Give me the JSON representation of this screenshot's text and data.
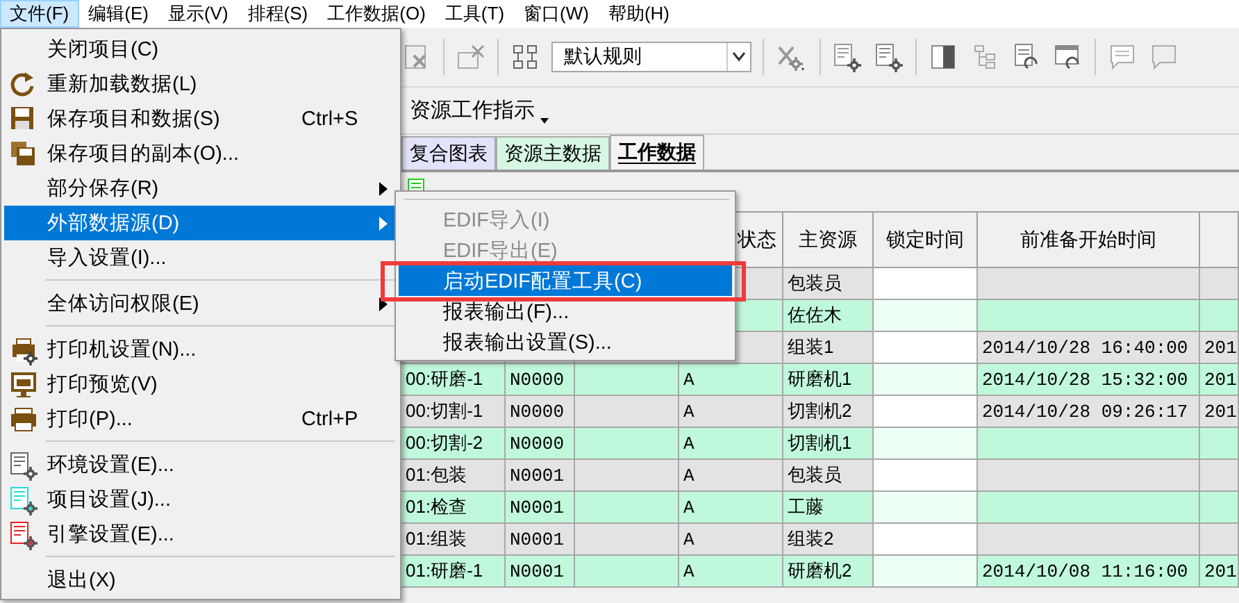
{
  "menu_bar": [
    {
      "label": "文件(F)",
      "selected": true
    },
    {
      "label": "编辑(E)",
      "selected": false
    },
    {
      "label": "显示(V)",
      "selected": false
    },
    {
      "label": "排程(S)",
      "selected": false
    },
    {
      "label": "工作数据(O)",
      "selected": false
    },
    {
      "label": "工具(T)",
      "selected": false
    },
    {
      "label": "窗口(W)",
      "selected": false
    },
    {
      "label": "帮助(H)",
      "selected": false
    }
  ],
  "toolbar": {
    "rule_select": {
      "value": "默认规则"
    }
  },
  "view_selector": {
    "label": "资源工作指示"
  },
  "tabs": [
    {
      "label": "复合图表",
      "selected": false,
      "color": "#e2e2fa"
    },
    {
      "label": "资源主数据",
      "selected": false,
      "color": "#d6f7e2"
    },
    {
      "label": "工作数据",
      "selected": true,
      "color": "#f4f4f4"
    }
  ],
  "table": {
    "columns": [
      {
        "label": "状态"
      },
      {
        "label": "主资源"
      },
      {
        "label": "锁定时间"
      },
      {
        "label": "前准备开始时间"
      }
    ],
    "rows": [
      {
        "main_resource": "包装员"
      },
      {
        "main_resource": "佐佐木"
      },
      {
        "main_resource": "组装1",
        "setup_start": "2014/10/28 16:40:00",
        "column_8": "201"
      },
      {
        "column_1": "00:研磨-1",
        "column_2": "N0000",
        "status": "A",
        "main_resource": "研磨机1",
        "setup_start": "2014/10/28 15:32:00",
        "column_8": "201"
      },
      {
        "column_1": "00:切割-1",
        "column_2": "N0000",
        "status": "A",
        "main_resource": "切割机2",
        "setup_start": "2014/10/28 09:26:17",
        "column_8": "201"
      },
      {
        "column_1": "00:切割-2",
        "column_2": "N0000",
        "status": "A",
        "main_resource": "切割机1"
      },
      {
        "column_1": "01:包装",
        "column_2": "N0001",
        "status": "A",
        "main_resource": "包装员"
      },
      {
        "column_1": "01:检查",
        "column_2": "N0001",
        "status": "A",
        "main_resource": "工藤"
      },
      {
        "column_1": "01:组装",
        "column_2": "N0001",
        "status": "A",
        "main_resource": "组装2"
      },
      {
        "column_1": "01:研磨-1",
        "column_2": "N0001",
        "status": "A",
        "main_resource": "研磨机2",
        "setup_start": "2014/10/08 11:16:00",
        "column_8": "201"
      }
    ]
  },
  "file_menu": {
    "items": [
      {
        "label": "关闭项目(C)",
        "selected": false,
        "separator_above": false,
        "submenu": false
      },
      {
        "label": "重新加载数据(L)",
        "selected": false,
        "separator_above": false,
        "submenu": false
      },
      {
        "label": "保存项目和数据(S)",
        "shortcut": "Ctrl+S",
        "selected": false,
        "separator_above": false,
        "submenu": false
      },
      {
        "label": "保存项目的副本(O)...",
        "selected": false,
        "separator_above": false,
        "submenu": false
      },
      {
        "label": "部分保存(R)",
        "selected": false,
        "separator_above": false,
        "submenu": true
      },
      {
        "label": "外部数据源(D)",
        "selected": true,
        "separator_above": false,
        "submenu": true
      },
      {
        "label": "导入设置(I)...",
        "selected": false,
        "separator_above": false,
        "submenu": false
      },
      {
        "label": "全体访问权限(E)",
        "selected": false,
        "separator_above": true,
        "submenu": true
      },
      {
        "label": "打印机设置(N)...",
        "selected": false,
        "separator_above": true,
        "submenu": false
      },
      {
        "label": "打印预览(V)",
        "selected": false,
        "separator_above": false,
        "submenu": false
      },
      {
        "label": "打印(P)...",
        "shortcut": "Ctrl+P",
        "selected": false,
        "separator_above": false,
        "submenu": false
      },
      {
        "label": "环境设置(E)...",
        "selected": false,
        "separator_above": true,
        "submenu": false
      },
      {
        "label": "项目设置(J)...",
        "selected": false,
        "separator_above": false,
        "submenu": false
      },
      {
        "label": "引擎设置(E)...",
        "selected": false,
        "separator_above": false,
        "submenu": false
      },
      {
        "label": "退出(X)",
        "selected": false,
        "separator_above": true,
        "submenu": false
      }
    ]
  },
  "submenu": {
    "items": [
      {
        "label": "EDIF导入(I)",
        "disabled": true,
        "selected": false,
        "separator_above": true
      },
      {
        "label": "EDIF导出(E)",
        "disabled": true,
        "selected": false,
        "separator_above": false
      },
      {
        "label": "启动EDIF配置工具(C)",
        "disabled": false,
        "selected": true,
        "separator_above": false
      },
      {
        "label": "报表输出(F)...",
        "disabled": false,
        "selected": false,
        "separator_above": false
      },
      {
        "label": "报表输出设置(S)...",
        "disabled": false,
        "selected": false,
        "separator_above": false
      }
    ]
  }
}
